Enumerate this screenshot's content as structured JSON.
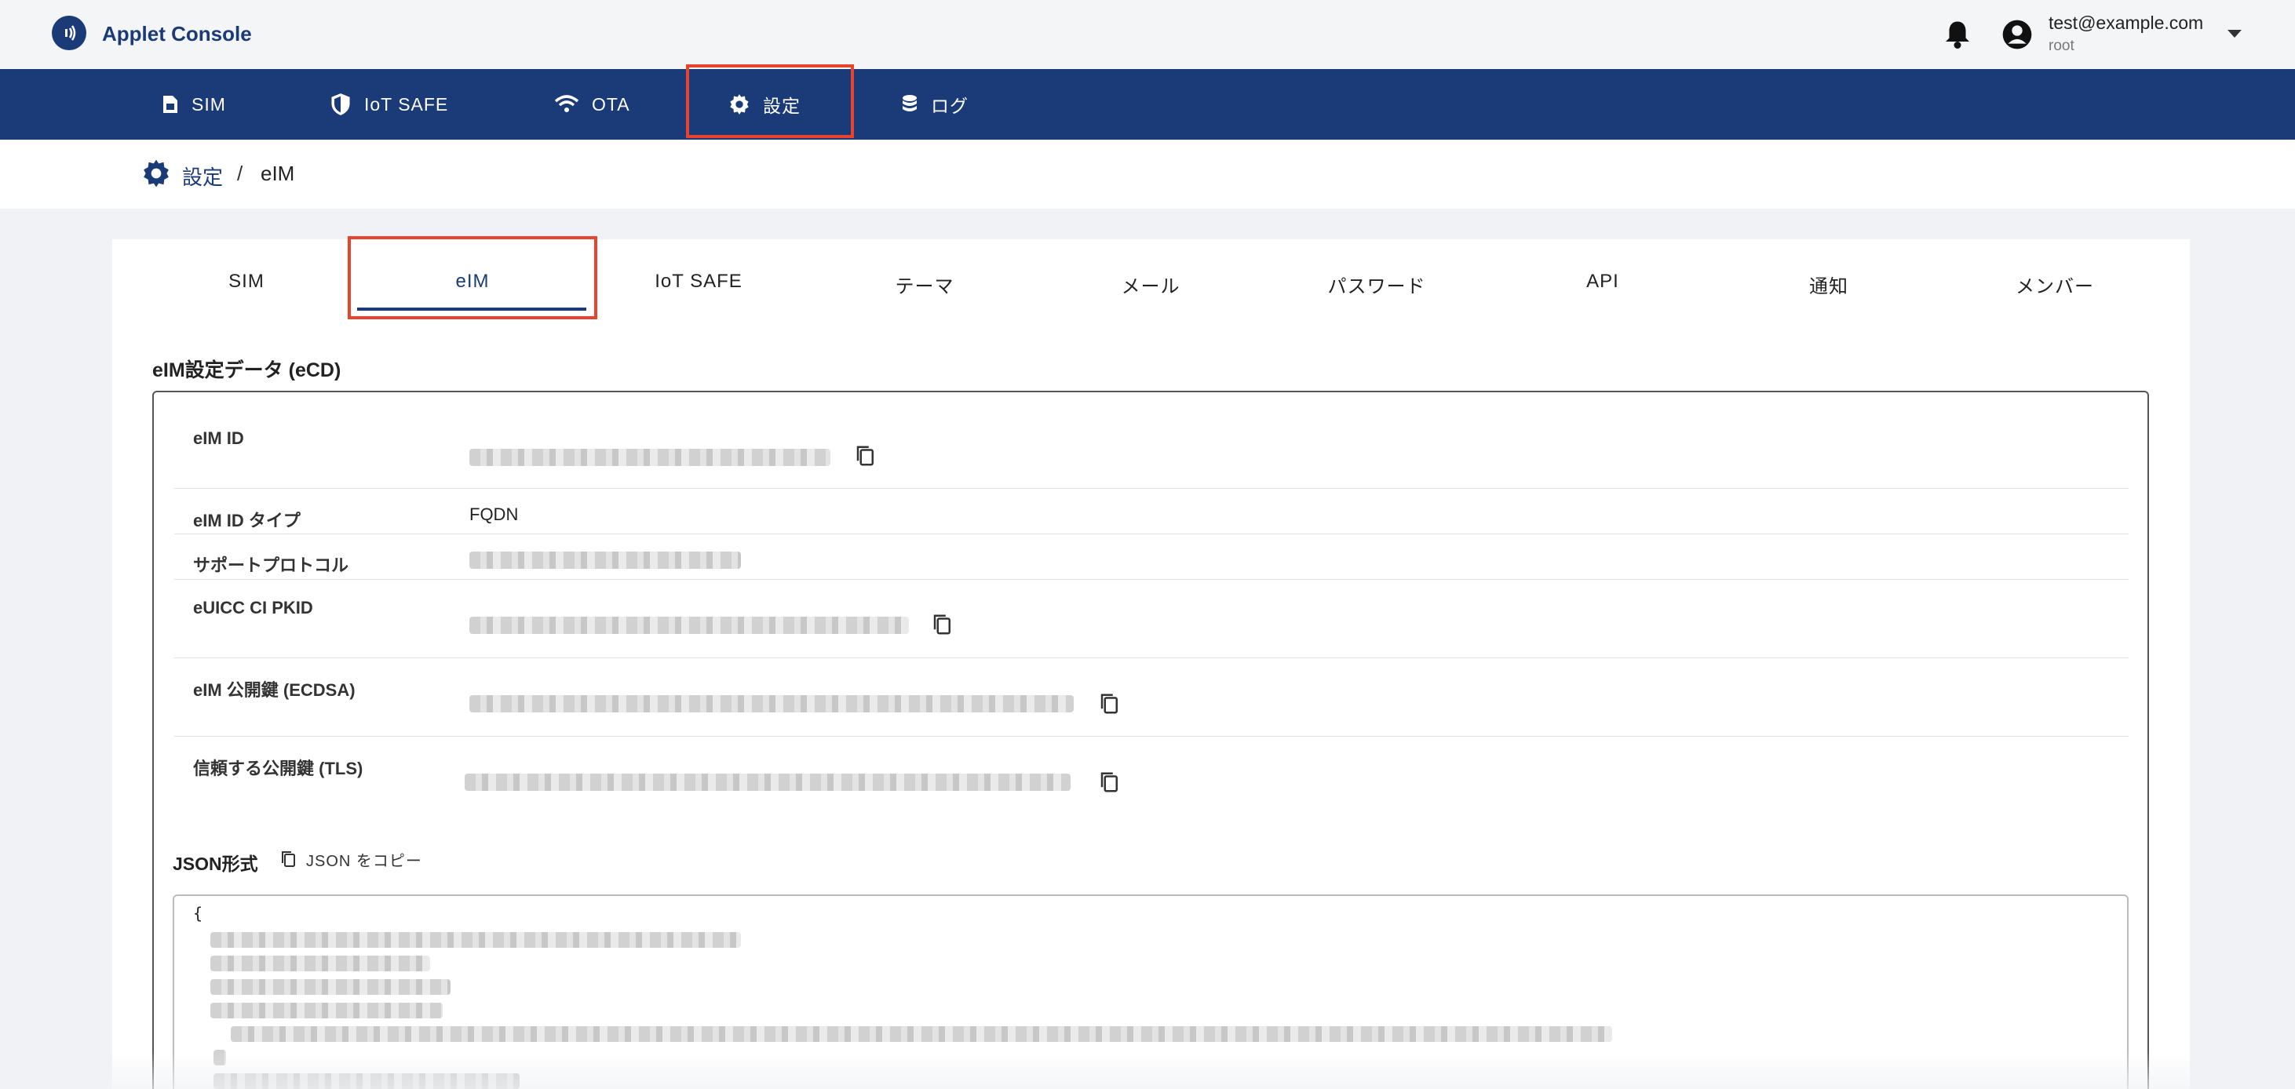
{
  "header": {
    "app_title": "Applet Console",
    "logo_icon": "wireless-chip-icon",
    "user_email": "test@example.com",
    "user_role": "root"
  },
  "nav": {
    "items": [
      {
        "label": "SIM",
        "icon": "sim-card-icon"
      },
      {
        "label": "IoT SAFE",
        "icon": "shield-icon"
      },
      {
        "label": "OTA",
        "icon": "wifi-icon"
      },
      {
        "label": "設定",
        "icon": "gear-icon",
        "active": true
      },
      {
        "label": "ログ",
        "icon": "database-icon"
      }
    ]
  },
  "breadcrumb": {
    "parent": "設定",
    "separator": "/",
    "current": "eIM"
  },
  "tabs": [
    {
      "label": "SIM"
    },
    {
      "label": "eIM",
      "active": true
    },
    {
      "label": "IoT SAFE"
    },
    {
      "label": "テーマ"
    },
    {
      "label": "メール"
    },
    {
      "label": "パスワード"
    },
    {
      "label": "API"
    },
    {
      "label": "通知"
    },
    {
      "label": "メンバー"
    }
  ],
  "ecd": {
    "title": "eIM設定データ (eCD)",
    "rows": [
      {
        "label": "eIM ID",
        "value": ""
      },
      {
        "label": "eIM ID タイプ",
        "value": "FQDN"
      },
      {
        "label": "サポートプロトコル",
        "value": ""
      },
      {
        "label": "eUICC CI PKID",
        "value": ""
      },
      {
        "label": "eIM 公開鍵 (ECDSA)",
        "value": ""
      },
      {
        "label": "信頼する公開鍵 (TLS)",
        "value": ""
      }
    ]
  },
  "json_section": {
    "title": "JSON形式",
    "copy_label": "JSON をコピー",
    "open_brace": "{"
  },
  "colors": {
    "brand": "#1b3a78",
    "highlight": "#e8432f",
    "background": "#f0f2f5"
  }
}
